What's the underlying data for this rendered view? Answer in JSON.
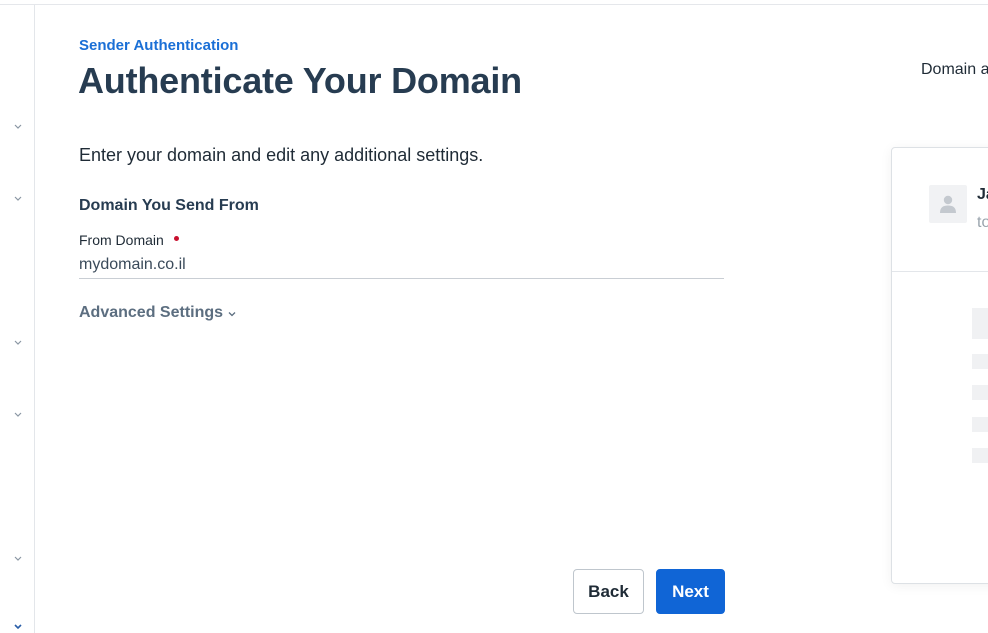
{
  "breadcrumb": "Sender Authentication",
  "page_title": "Authenticate Your Domain",
  "intro_text": "Enter your domain and edit any additional settings.",
  "section": {
    "heading": "Domain You Send From",
    "field_label": "From Domain",
    "field_value": "mydomain.co.il"
  },
  "advanced_settings_label": "Advanced Settings",
  "buttons": {
    "back": "Back",
    "next": "Next"
  },
  "preview": {
    "heading": "Domain a",
    "sender_name": "Ja",
    "sender_to": "to"
  },
  "colors": {
    "accent": "#1065d6",
    "title": "#273c51",
    "required": "#c8102e"
  }
}
